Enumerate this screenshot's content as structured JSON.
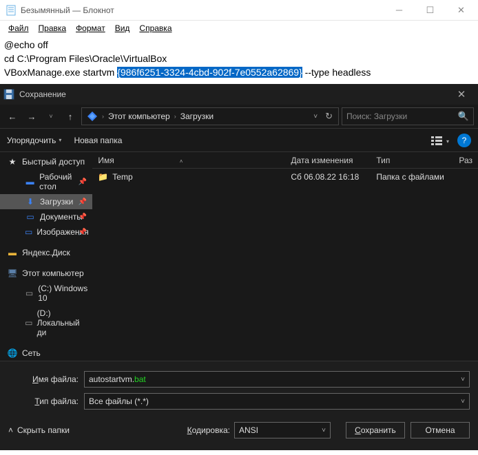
{
  "notepad": {
    "title": "Безымянный — Блокнот",
    "menu": {
      "file": "Файл",
      "edit": "Правка",
      "format": "Формат",
      "view": "Вид",
      "help": "Справка"
    },
    "line1": "@echo off",
    "line2": "cd C:\\Program Files\\Oracle\\VirtualBox",
    "line3_pre": "VBoxManage.exe startvm ",
    "line3_sel": "{986f6251-3324-4cbd-902f-7e0552a62869}",
    "line3_post": " --type headless"
  },
  "dialog": {
    "title": "Сохранение",
    "breadcrumb": {
      "root": "Этот компьютер",
      "folder": "Загрузки"
    },
    "search_placeholder": "Поиск: Загрузки",
    "toolbar": {
      "organize": "Упорядочить",
      "newfolder": "Новая папка"
    },
    "columns": {
      "name": "Имя",
      "date": "Дата изменения",
      "type": "Тип",
      "size": "Раз"
    },
    "tree": {
      "quick": "Быстрый доступ",
      "desktop": "Рабочий стол",
      "downloads": "Загрузки",
      "documents": "Документы",
      "pictures": "Изображения",
      "yadisk": "Яндекс.Диск",
      "thispc": "Этот компьютер",
      "drive_c": "(C:) Windows 10",
      "drive_d": "(D:) Локальный ди",
      "network": "Сеть"
    },
    "rows": [
      {
        "name": "Temp",
        "date": "Сб 06.08.22 16:18",
        "type": "Папка с файлами"
      }
    ],
    "filename_label_pre": "Имя файла:",
    "filename_label_ul": "И",
    "filename_label_rest": "мя файла:",
    "filename_value_base": "autostartvm.",
    "filename_value_ext": "bat",
    "filetype_label_ul": "Т",
    "filetype_label_rest": "ип файла:",
    "filetype_value": "Все файлы  (*.*)",
    "hide_folders": "Скрыть папки",
    "encoding_label_ul": "К",
    "encoding_label_rest": "одировка:",
    "encoding_value": "ANSI",
    "save_ul": "С",
    "save_rest": "охранить",
    "cancel": "Отмена"
  }
}
